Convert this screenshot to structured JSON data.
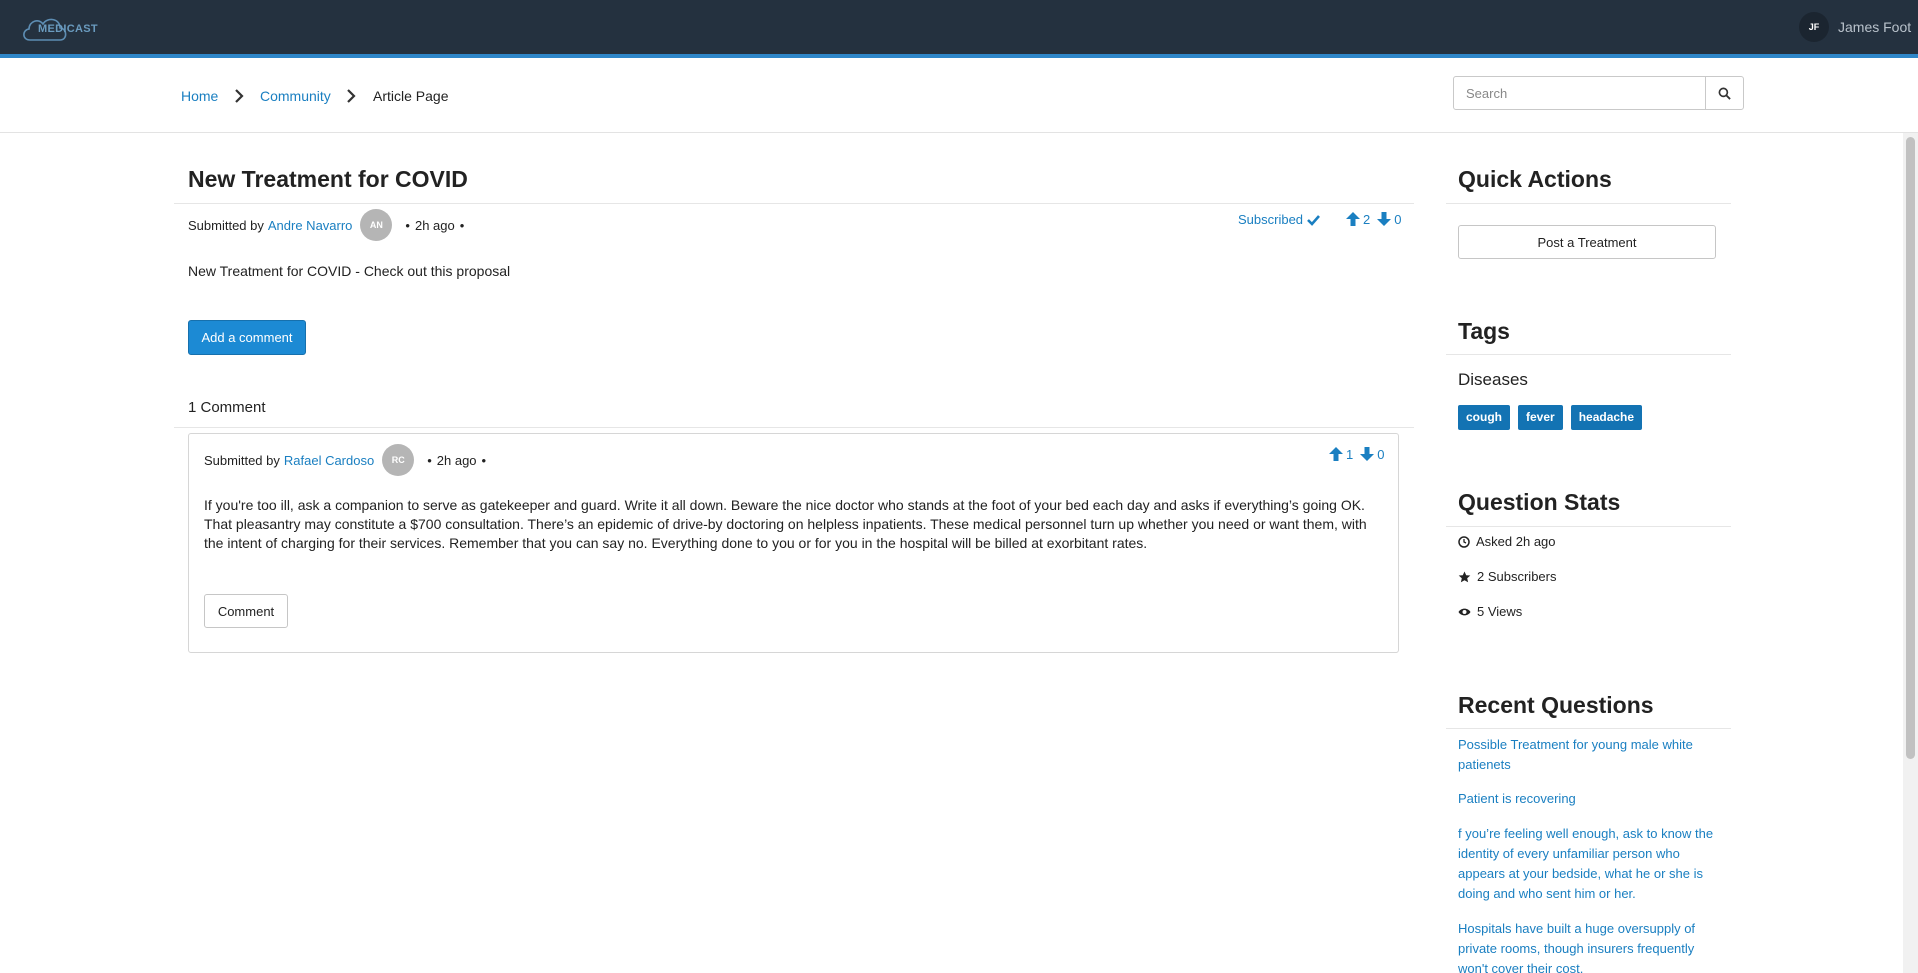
{
  "header": {
    "logo_text": "MEDICAST",
    "user_initials": "JF",
    "user_name": "James Foot"
  },
  "breadcrumb": {
    "items": [
      {
        "label": "Home"
      },
      {
        "label": "Community"
      },
      {
        "label": "Article Page"
      }
    ]
  },
  "search": {
    "placeholder": "Search",
    "value": ""
  },
  "article": {
    "title": "New Treatment for COVID",
    "submitted_by_label": "Submitted by",
    "author": "Andre Navarro",
    "author_initials": "AN",
    "time": "2h ago",
    "subscribed_label": "Subscribed",
    "upvotes": "2",
    "downvotes": "0",
    "body": "New Treatment for COVID - Check out this proposal",
    "add_comment_label": "Add a comment"
  },
  "comments": {
    "count_label": "1 Comment",
    "items": [
      {
        "submitted_by_label": "Submitted by",
        "author": "Rafael Cardoso",
        "author_initials": "RC",
        "time": "2h ago",
        "upvotes": "1",
        "downvotes": "0",
        "body": "If you're too ill, ask a companion to serve as gatekeeper and guard. Write it all down. Beware the nice doctor who stands at the foot of your bed each day and asks if everything’s going OK. That pleasantry may constitute a $700 consultation. There’s an epidemic of drive-by doctoring on helpless inpatients. These medical personnel turn up whether you need or want them, with the intent of charging for their services. Remember that you can say no. Everything done to you or for you in the hospital will be billed at exorbitant rates.",
        "comment_button_label": "Comment"
      }
    ]
  },
  "sidebar": {
    "quick_actions": {
      "heading": "Quick Actions",
      "post_button_label": "Post a Treatment"
    },
    "tags": {
      "heading": "Tags",
      "group_label": "Diseases",
      "items": [
        "cough",
        "fever",
        "headache"
      ]
    },
    "stats": {
      "heading": "Question Stats",
      "asked": "Asked 2h ago",
      "subscribers": "2 Subscribers",
      "views": "5 Views"
    },
    "recent": {
      "heading": "Recent Questions",
      "items": [
        "Possible Treatment for young male white patienets",
        "Patient is recovering",
        "f you’re feeling well enough, ask to know the identity of every unfamiliar person who appears at your bedside, what he or she is doing and who sent him or her.",
        "Hospitals have built a huge oversupply of private rooms, though insurers frequently won't cover their cost."
      ]
    }
  },
  "colors": {
    "header_bg": "#24313f",
    "header_accent": "#2e86c8",
    "link": "#1a7fc1",
    "primary_button": "#1c8ad4",
    "tag_bg": "#1373b3"
  }
}
